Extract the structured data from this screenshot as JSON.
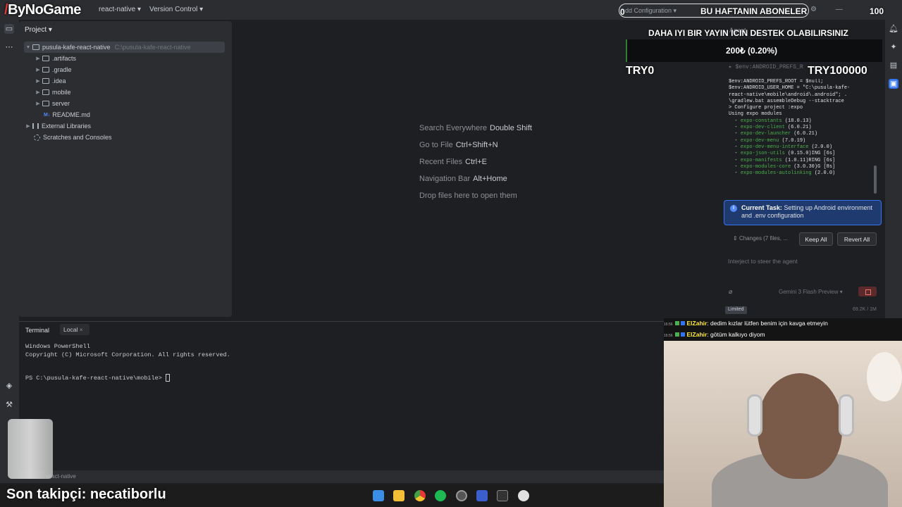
{
  "overlay": {
    "brand": "ByNoGame",
    "subs_title": "BU HAFTANIN ABONELER",
    "subs_count": "100",
    "subs_zero": "0",
    "support_text": "DAHA IYI BIR YAYIN ICIN DESTEK OLABILIRSINIZ",
    "goal_text": "200₺ (0.20%)",
    "goal_min": "TRY0",
    "goal_max": "TRY100000",
    "last_follower": "Son takipçi: necatiborlu"
  },
  "titlebar": {
    "project_menu": "react-native",
    "vcs_menu": "Version Control",
    "run_config": "dd Configuration"
  },
  "project_panel": {
    "header": "Project",
    "root_name": "pusula-kafe-react-native",
    "root_path": "C:\\pusula-kafe-react-native",
    "items": [
      {
        "label": ".artifacts"
      },
      {
        "label": ".gradle"
      },
      {
        "label": ".idea"
      },
      {
        "label": "mobile"
      },
      {
        "label": "server"
      },
      {
        "label": "README.md"
      }
    ],
    "external_libraries": "External Libraries",
    "scratches": "Scratches and Consoles"
  },
  "editor_hints": [
    {
      "label": "Search Everywhere",
      "key": "Double Shift"
    },
    {
      "label": "Go to File",
      "key": "Ctrl+Shift+N"
    },
    {
      "label": "Recent Files",
      "key": "Ctrl+E"
    },
    {
      "label": "Navigation Bar",
      "key": "Alt+Home"
    },
    {
      "label": "Drop files here to open them",
      "key": ""
    }
  ],
  "agent": {
    "title": "Agent",
    "command_head": "$env:ANDROID_PREFS_R",
    "command_lines": [
      "$env:ANDROID_PREFS_ROOT = $null;",
      "$env:ANDROID_USER_HOME = \"C:\\pusula-kafe-",
      "react-native\\mobile\\android\\.android\"; .",
      "\\gradlew.bat assembleDebug --stacktrace",
      "",
      "> Configure project :expo",
      "",
      "Using expo modules"
    ],
    "modules": [
      {
        "name": "expo-constants",
        "ver": "(18.0.13)",
        "tail": ""
      },
      {
        "name": "expo-dev-client",
        "ver": "(6.0.21)",
        "tail": ""
      },
      {
        "name": "expo-dev-launcher",
        "ver": "(6.0.21)",
        "tail": ""
      },
      {
        "name": "expo-dev-menu",
        "ver": "(7.0.19)",
        "tail": ""
      },
      {
        "name": "expo-dev-menu-interface",
        "ver": "(2.0.0)",
        "tail": ""
      },
      {
        "name": "expo-json-utils",
        "ver": "(0.15.0)",
        "tail": "ING [6s]"
      },
      {
        "name": "expo-manifests",
        "ver": "(1.0.11)",
        "tail": "RING [6s]"
      },
      {
        "name": "expo-modules-core",
        "ver": "(3.0.30)",
        "tail": "G [8s]"
      },
      {
        "name": "expo-modules-autolinking",
        "ver": "(2.0.0)",
        "tail": ""
      }
    ],
    "task_label": "Current Task:",
    "task_text": "Setting up Android environment and .env configuration",
    "changes": "Changes (7 files, ...",
    "keep_all": "Keep All",
    "revert_all": "Revert All",
    "input_placeholder": "Interject to steer the agent",
    "model": "Gemini 3 Flash Preview",
    "limited": "Limited",
    "tokens": "69.2K / 1M"
  },
  "terminal": {
    "tab": "Terminal",
    "local_tab": "Local",
    "lines": [
      "Windows PowerShell",
      "Copyright (C) Microsoft Corporation. All rights reserved."
    ],
    "prompt": "PS C:\\pusula-kafe-react-native\\mobile> "
  },
  "status": {
    "path": "react-native"
  },
  "chat": [
    {
      "time": "16:56",
      "user": "ElZahir",
      "text": ": dedim kızlar lütfen benim için kavga etmeyin"
    },
    {
      "time": "16:56",
      "user": "ElZahir",
      "text": ": götüm kalkıyo diyom"
    }
  ],
  "colors": {
    "accent": "#3574f0",
    "ide_bg": "#1e1f22",
    "panel_bg": "#2b2d30"
  }
}
